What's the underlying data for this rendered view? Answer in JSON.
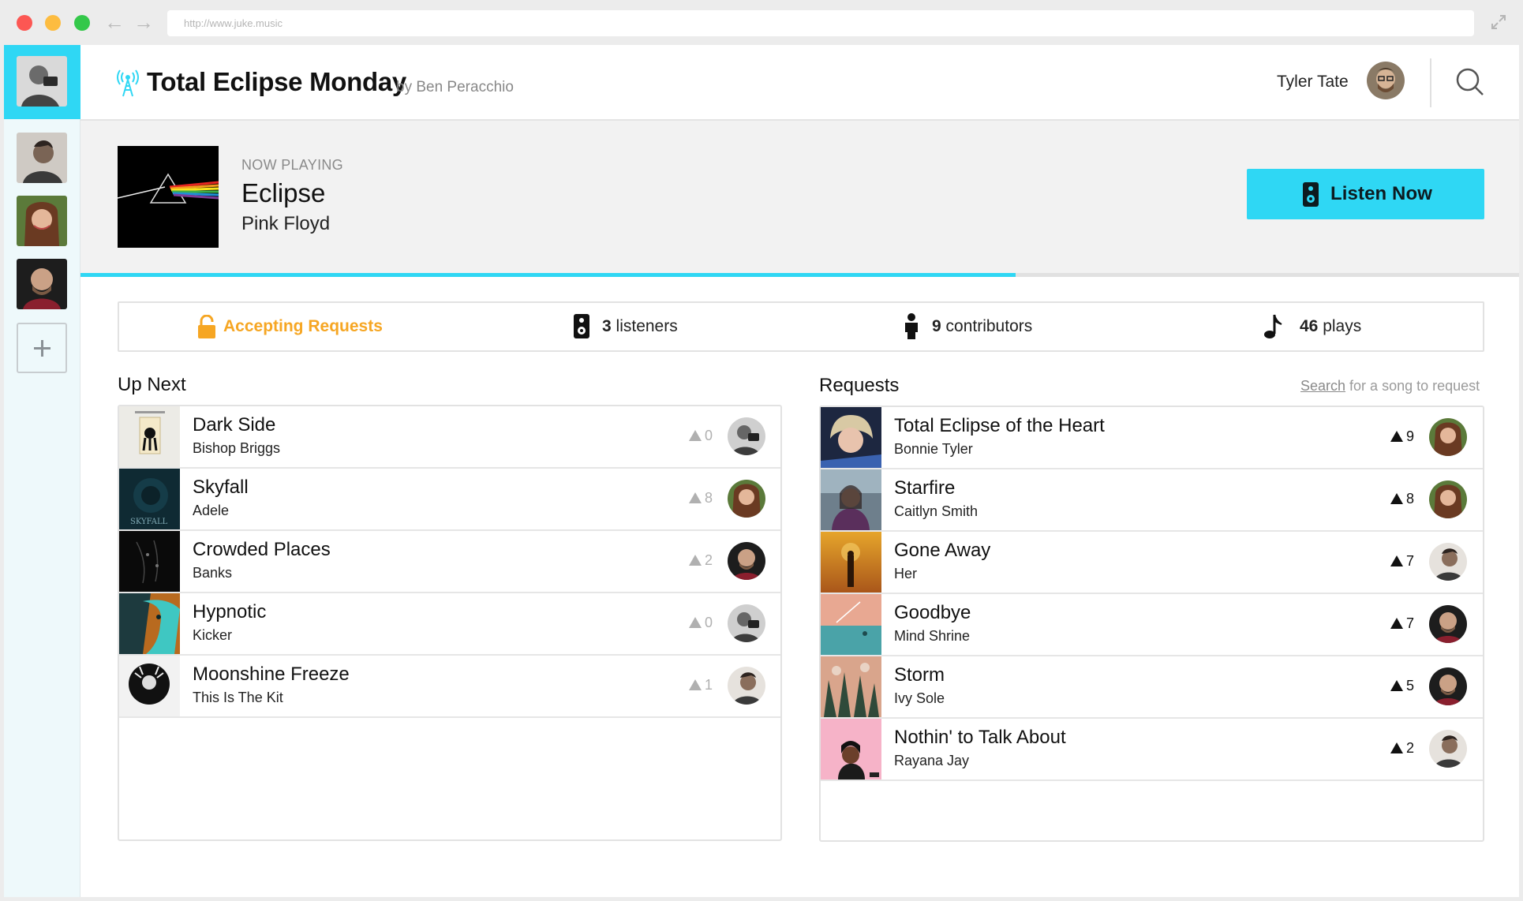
{
  "browser": {
    "url": "http://www.juke.music"
  },
  "sidebar": {
    "stations": [
      {
        "name": "station-1",
        "active": true
      },
      {
        "name": "station-2",
        "active": false
      },
      {
        "name": "station-3",
        "active": false
      },
      {
        "name": "station-4",
        "active": false
      }
    ],
    "add_icon": "plus-icon"
  },
  "header": {
    "station_title": "Total Eclipse Monday",
    "station_by": "by Ben Peracchio",
    "user_name": "Tyler Tate",
    "broadcast_icon": "broadcast-tower-icon",
    "search_icon": "search-icon"
  },
  "now_playing": {
    "label": "NOW PLAYING",
    "title": "Eclipse",
    "artist": "Pink Floyd",
    "listen_label": "Listen Now",
    "progress": 0.65
  },
  "stats": {
    "accepting": "Accepting Requests",
    "listeners_count": "3",
    "listeners_label": "listeners",
    "contributors_count": "9",
    "contributors_label": "contributors",
    "plays_count": "46",
    "plays_label": "plays"
  },
  "up_next": {
    "heading": "Up Next",
    "items": [
      {
        "title": "Dark Side",
        "artist": "Bishop Briggs",
        "votes": "0"
      },
      {
        "title": "Skyfall",
        "artist": "Adele",
        "votes": "8"
      },
      {
        "title": "Crowded Places",
        "artist": "Banks",
        "votes": "2"
      },
      {
        "title": "Hypnotic",
        "artist": "Kicker",
        "votes": "0"
      },
      {
        "title": "Moonshine Freeze",
        "artist": "This Is The Kit",
        "votes": "1"
      }
    ]
  },
  "requests": {
    "heading": "Requests",
    "hint_link": "Search",
    "hint_rest": " for a song to request",
    "items": [
      {
        "title": "Total Eclipse of the Heart",
        "artist": "Bonnie Tyler",
        "votes": "9"
      },
      {
        "title": "Starfire",
        "artist": "Caitlyn Smith",
        "votes": "8"
      },
      {
        "title": "Gone Away",
        "artist": "Her",
        "votes": "7"
      },
      {
        "title": "Goodbye",
        "artist": "Mind Shrine",
        "votes": "7"
      },
      {
        "title": "Storm",
        "artist": "Ivy Sole",
        "votes": "5"
      },
      {
        "title": "Nothin' to Talk About",
        "artist": "Rayana Jay",
        "votes": "2"
      }
    ]
  },
  "colors": {
    "accent": "#2fd7f4",
    "accepting": "#f6a623"
  }
}
